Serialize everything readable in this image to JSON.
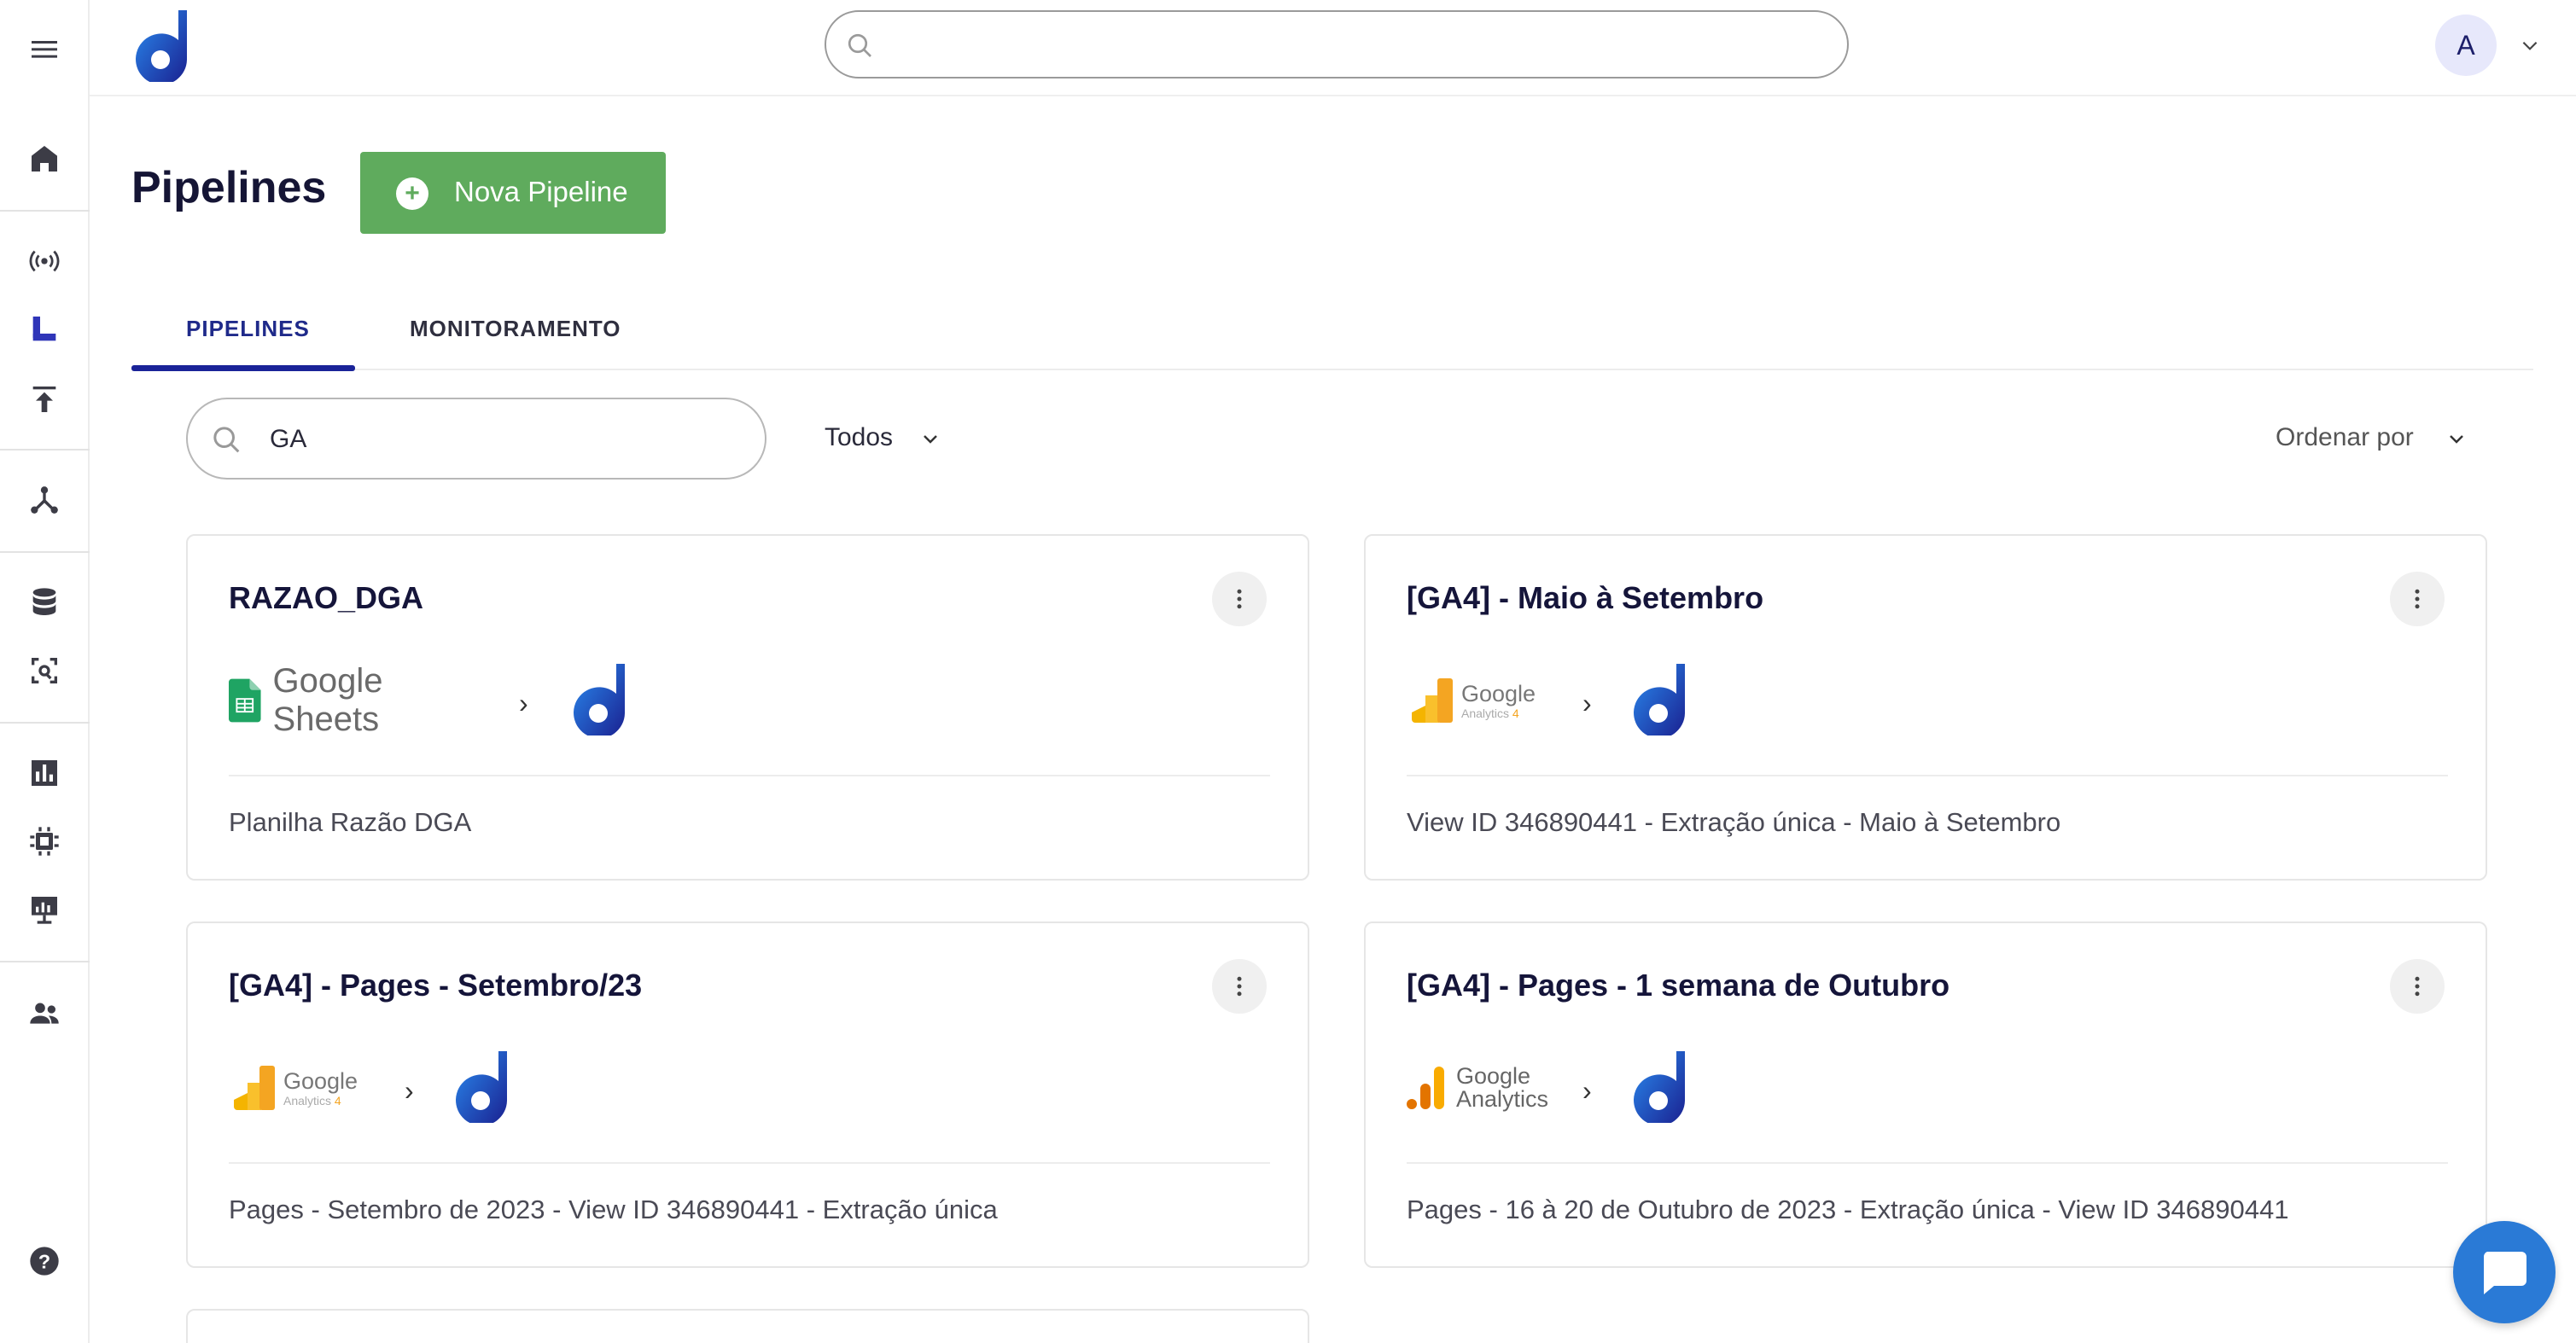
{
  "header": {
    "page_title": "Pipelines",
    "new_button_label": "Nova Pipeline",
    "avatar_initial": "A"
  },
  "tabs": [
    {
      "label": "PIPELINES",
      "active": true
    },
    {
      "label": "MONITORAMENTO",
      "active": false
    }
  ],
  "filters": {
    "search_value": "GA",
    "type_filter": "Todos",
    "order_by": "Ordenar por"
  },
  "sidebar": {
    "items": [
      "menu-icon",
      "home-icon",
      "broadcast-icon",
      "pipelines-icon",
      "upload-icon",
      "network-icon",
      "database-icon",
      "scan-search-icon",
      "bar-chart-icon",
      "chip-icon",
      "presentation-icon",
      "users-icon",
      "help-icon"
    ]
  },
  "cards": [
    {
      "title": "RAZAO_DGA",
      "source": "Google Sheets",
      "description": "Planilha Razão DGA"
    },
    {
      "title": "[GA4] - Maio à Setembro",
      "source": "Google Analytics 4",
      "description": "View ID 346890441 - Extração única - Maio à Setembro"
    },
    {
      "title": "[GA4] - Pages - Setembro/23",
      "source": "Google Analytics 4",
      "description": "Pages - Setembro de 2023 - View ID 346890441 - Extração única"
    },
    {
      "title": "[GA4] - Pages - 1 semana de Outubro",
      "source": "Google Analytics",
      "description": "Pages - 16 à 20 de Outubro de 2023 - Extração única - View ID 346890441"
    }
  ],
  "logo_text": {
    "sheets_a": "Google",
    "sheets_b": "Sheets",
    "ga_a": "Google",
    "ga_b": "Analytics",
    "ga_b_4": "4"
  },
  "colors": {
    "brand_blue": "#1a2398",
    "button_green": "#5fab5d",
    "chat_blue": "#2a7ad6"
  }
}
